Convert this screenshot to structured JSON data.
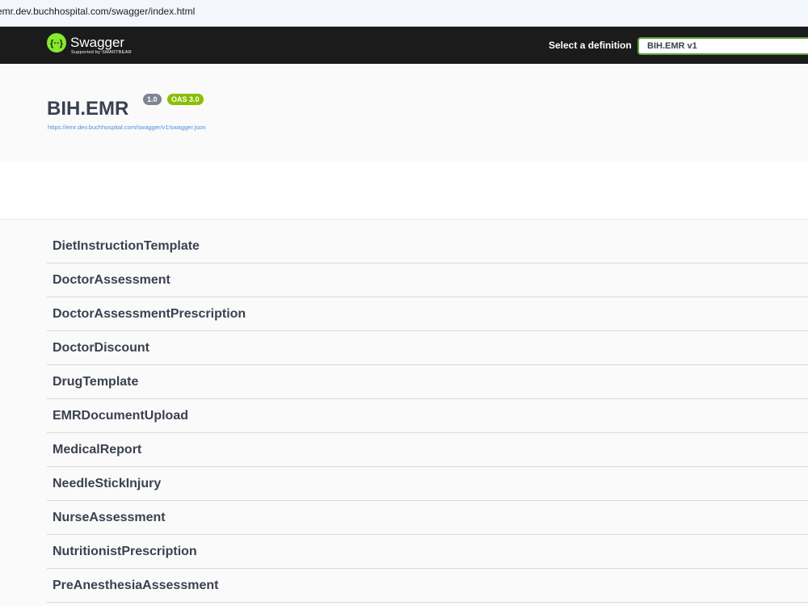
{
  "browser": {
    "url": "emr.dev.buchhospital.com/swagger/index.html"
  },
  "topbar": {
    "logo_icon": "swagger-braces-icon",
    "logo_text": "Swagger",
    "logo_subtext": "Supported by SMARTBEAR",
    "definition_label": "Select a definition",
    "definition_value": "BIH.EMR v1",
    "accent_color": "#85ea2d"
  },
  "info": {
    "title": "BIH.EMR",
    "version": "1.0",
    "oas_badge": "OAS 3.0",
    "spec_url": "https://emr.dev.buchhospital.com/swagger/v1/swagger.json"
  },
  "tags": [
    {
      "label": "DietInstructionTemplate"
    },
    {
      "label": "DoctorAssessment"
    },
    {
      "label": "DoctorAssessmentPrescription"
    },
    {
      "label": "DoctorDiscount"
    },
    {
      "label": "DrugTemplate"
    },
    {
      "label": "EMRDocumentUpload"
    },
    {
      "label": "MedicalReport"
    },
    {
      "label": "NeedleStickInjury"
    },
    {
      "label": "NurseAssessment"
    },
    {
      "label": "NutritionistPrescription"
    },
    {
      "label": "PreAnesthesiaAssessment"
    }
  ]
}
